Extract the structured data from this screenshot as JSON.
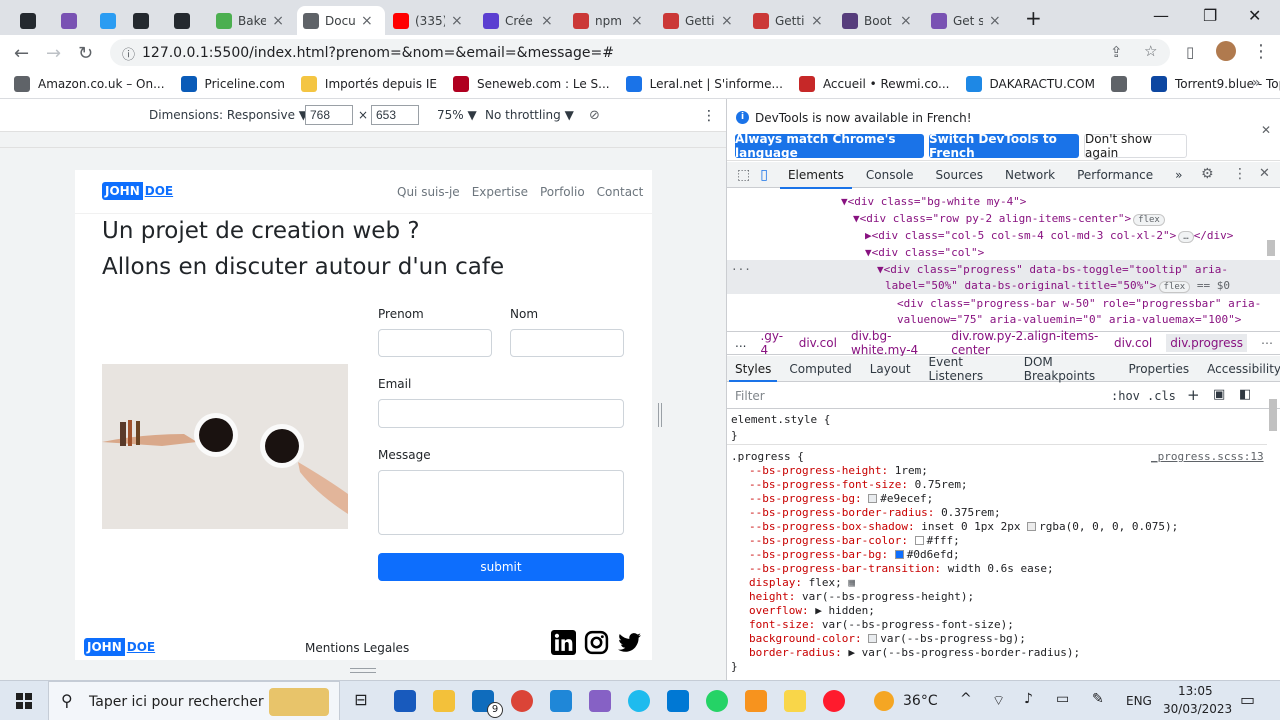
{
  "tabs": [
    {
      "title": "",
      "icon": "github-icon",
      "color": "#24292f"
    },
    {
      "title": "",
      "icon": "bootstrap-icon",
      "color": "#7952b3"
    },
    {
      "title": "",
      "icon": "bootstrap-icon",
      "color": "#2b9cf2"
    },
    {
      "title": "",
      "icon": "github-icon",
      "color": "#24292f"
    },
    {
      "title": "",
      "icon": "github-icon",
      "color": "#24292f"
    },
    {
      "title": "Bake",
      "icon": "bake-icon",
      "color": "#4caf50"
    },
    {
      "title": "Docu",
      "icon": "globe-icon",
      "color": "#5f6368"
    },
    {
      "title": "(335)",
      "icon": "youtube-icon",
      "color": "#ff0000"
    },
    {
      "title": "Crée",
      "icon": "create-icon",
      "color": "#5b3fd1"
    },
    {
      "title": "npm",
      "icon": "npm-icon",
      "color": "#cb3837"
    },
    {
      "title": "Getti",
      "icon": "npm-icon",
      "color": "#cb3837"
    },
    {
      "title": "Getti",
      "icon": "npm-icon",
      "color": "#cb3837"
    },
    {
      "title": "Boot",
      "icon": "bootstrap-icon",
      "color": "#563d7c"
    },
    {
      "title": "Get s",
      "icon": "bootstrap-icon",
      "color": "#7952b3"
    }
  ],
  "address": {
    "url": "127.0.0.1:5500/index.html?prenom=&nom=&email=&message=#"
  },
  "bookmarks": [
    {
      "label": "Amazon.co.uk – On...",
      "color": "#5f6368"
    },
    {
      "label": "Priceline.com",
      "color": "#0a5bb8"
    },
    {
      "label": "Importés depuis IE",
      "color": "#f4c542"
    },
    {
      "label": "Seneweb.com : Le S...",
      "color": "#b00020"
    },
    {
      "label": "Leral.net | S'informe...",
      "color": "#1a73e8"
    },
    {
      "label": "Accueil • Rewmi.co...",
      "color": "#c62828"
    },
    {
      "label": "DAKARACTU.COM",
      "color": "#1e88e5"
    },
    {
      "label": "",
      "color": "#5f6368"
    },
    {
      "label": "Torrent9.blue - Top...",
      "color": "#0d47a1"
    }
  ],
  "devbar": {
    "dimensions": "Dimensions: Responsive ▼",
    "width": "768",
    "height": "653",
    "zoom": "75% ▼",
    "throttle": "No throttling ▼",
    "x": "×"
  },
  "site": {
    "brand1": "JOHN",
    "brand2": "DOE",
    "nav": [
      "Qui suis-je",
      "Expertise",
      "Porfolio",
      "Contact"
    ],
    "h1_line1": "Un projet de creation web ?",
    "h1_line2": "Allons en discuter autour d'un cafe",
    "label_prenom": "Prenom",
    "label_nom": "Nom",
    "label_email": "Email",
    "label_message": "Message",
    "submit": "submit",
    "footer_legal": "Mentions Legales"
  },
  "devtools": {
    "notice": "DevTools is now available in French!",
    "btn_match": "Always match Chrome's language",
    "btn_switch": "Switch DevTools to French",
    "btn_dont": "Don't show again",
    "tabs": [
      "Elements",
      "Console",
      "Sources",
      "Network",
      "Performance",
      "»"
    ],
    "crumbs": [
      "...",
      ".gy-4",
      "div.col",
      "div.bg-white.my-4",
      "div.row.py-2.align-items-center",
      "div.col",
      "div.progress"
    ],
    "subtabs": [
      "Styles",
      "Computed",
      "Layout",
      "Event Listeners",
      "DOM Breakpoints",
      "Properties",
      "Accessibility"
    ],
    "filter": "Filter",
    "hov": ":hov",
    "cls": ".cls",
    "dom": {
      "l1": "▼<div class=\"bg-white my-4\">",
      "l2": "▼<div class=\"row py-2 align-items-center\">",
      "l2b": "flex",
      "l3": "▶<div class=\"col-5 col-sm-4 col-md-3 col-xl-2\">",
      "l3b": "…",
      "l3c": "</div>",
      "l4": "▼<div class=\"col\">",
      "l5a": "▼<div class=\"progress\" data-bs-toggle=\"tooltip\" aria-",
      "l5b": "label=\"50%\" data-bs-original-title=\"50%\">",
      "l5c": "flex",
      "l5d": "== $0",
      "l6a": "<div class=\"progress-bar w-50\" role=\"progressbar\" aria-",
      "l6b": "valuenow=\"75\" aria-valuemin=\"0\" aria-valuemax=\"100\">"
    },
    "styles": {
      "es": "element.style {",
      "esclose": "}",
      "sel": ".progress {",
      "src": "_progress.scss:13",
      "p1": "--bs-progress-height:",
      "v1": "1rem;",
      "p2": "--bs-progress-font-size:",
      "v2": "0.75rem;",
      "p3": "--bs-progress-bg:",
      "v3": "#e9ecef;",
      "p4": "--bs-progress-border-radius:",
      "v4": "0.375rem;",
      "p5": "--bs-progress-box-shadow:",
      "v5": "inset 0 1px 2px",
      "v5b": "rgba(0, 0, 0, 0.075);",
      "p6": "--bs-progress-bar-color:",
      "v6": "#fff;",
      "p7": "--bs-progress-bar-bg:",
      "v7": "#0d6efd;",
      "p8": "--bs-progress-bar-transition:",
      "v8": "width 0.6s ease;",
      "p9": "display:",
      "v9": "flex;",
      "p10": "height:",
      "v10": "var(--bs-progress-height);",
      "p11": "overflow:",
      "v11": "▶ hidden;",
      "p12": "font-size:",
      "v12": "var(--bs-progress-font-size);",
      "p13": "background-color:",
      "v13": "var(--bs-progress-bg);",
      "p14": "border-radius:",
      "v14": "▶ var(--bs-progress-border-radius);",
      "close": "}"
    }
  },
  "taskbar": {
    "search": "Taper ici pour rechercher",
    "temp": "36°C",
    "lang": "ENG",
    "time": "13:05",
    "date": "30/03/2023",
    "mail_badge": "9"
  }
}
